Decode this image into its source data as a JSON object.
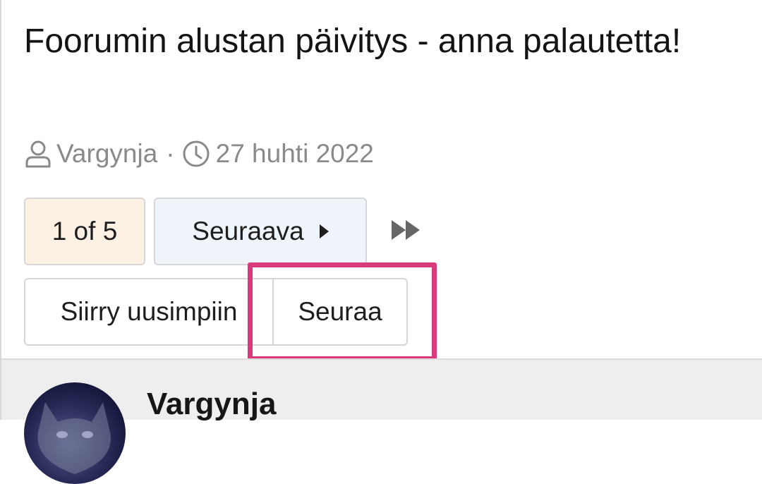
{
  "thread": {
    "title": "Foorumin alustan päivitys - anna palautetta!",
    "author": "Vargynja",
    "separator": "·",
    "date": "27 huhti 2022"
  },
  "pagination": {
    "page_label": "1 of 5",
    "next_label": "Seuraava",
    "last_icon": "fast-forward-icon"
  },
  "actions": {
    "latest_label": "Siirry uusimpiin",
    "follow_label": "Seuraa"
  },
  "post": {
    "author_name": "Vargynja"
  },
  "colors": {
    "highlight": "#d83a7c",
    "page_count_bg": "#fdf1e3",
    "next_bg": "#eff4fb"
  },
  "icons": {
    "author": "user-icon",
    "date": "clock-icon"
  }
}
